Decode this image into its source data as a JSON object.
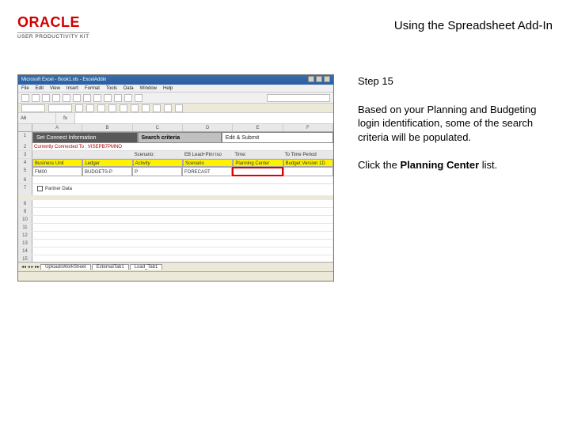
{
  "header": {
    "logo": "ORACLE",
    "logo_sub": "USER PRODUCTIVITY KIT",
    "doc_title": "Using the Spreadsheet Add-In"
  },
  "instructions": {
    "step_label": "Step 15",
    "body": "Based on your Planning and Budgeting login identification, some of the search criteria will be populated.",
    "action_prefix": "Click the ",
    "action_bold": "Planning Center",
    "action_suffix": " list."
  },
  "excel": {
    "title": "Microsoft Excel - Book1.xls - ExcelAddin",
    "menu": [
      "File",
      "Edit",
      "View",
      "Insert",
      "Format",
      "Tools",
      "Data",
      "Window",
      "Help"
    ],
    "help_hint": "Type a question for help",
    "namebox": "A6",
    "fx": "fx",
    "cols": [
      "A",
      "B",
      "C",
      "D",
      "E",
      "F"
    ],
    "band": {
      "b1": "Set Connect Information",
      "b2": "Search criteria",
      "b3": "Edit & Submit"
    },
    "subinfo": "Currently Connected To : VISEPB7PMNO",
    "scenario_row": [
      "",
      "",
      "Scenario:",
      "EB Lead+Ptnr iso",
      "Time:",
      "To Time Period"
    ],
    "yellow": [
      "Business Unit",
      "Ledger",
      "Activity",
      "Scenario",
      "Planning Center",
      "Budget Version 1D"
    ],
    "data": [
      "FM00",
      "BUDGETS-P",
      "P",
      "FORECAST",
      "",
      ""
    ],
    "checkbox_label": "Partner Data",
    "tabs": [
      "UploadsWorkSheet",
      "ExternalTab1",
      "Load_Tab1"
    ]
  }
}
